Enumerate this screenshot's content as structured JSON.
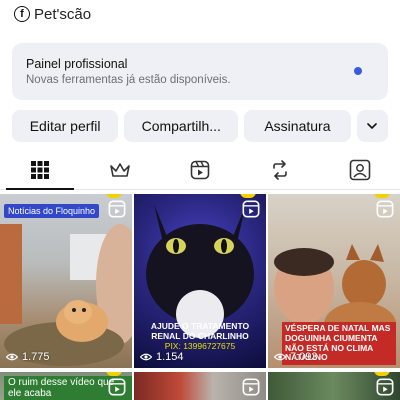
{
  "header": {
    "account_name": "Pet'scão",
    "icon": "facebook-icon"
  },
  "panel": {
    "title": "Painel profissional",
    "subtitle": "Novas ferramentas já estão disponíveis.",
    "notification_color": "#3a5bd9"
  },
  "buttons": {
    "edit": "Editar perfil",
    "share": "Compartilh...",
    "subscription": "Assinatura",
    "more_icon": "chevron-down-icon"
  },
  "tabs": [
    {
      "name": "grid",
      "icon": "grid-icon",
      "active": true
    },
    {
      "name": "crown",
      "icon": "crown-icon",
      "active": false
    },
    {
      "name": "reels",
      "icon": "reels-icon",
      "active": false
    },
    {
      "name": "repost",
      "icon": "repost-icon",
      "active": false
    },
    {
      "name": "tagged",
      "icon": "tagged-icon",
      "active": false
    }
  ],
  "posts": [
    {
      "tag": "Notícias do Floquinho",
      "views": "1.775"
    },
    {
      "caption": "AJUDE O TRATAMENTO RENAL DO CHARLINHO",
      "caption_extra": "PIX: 13996727675",
      "views": "1.154"
    },
    {
      "caption": "VÉSPERA DE NATAL MAS DOGUINHA CIUMENTA NÃO ESTÁ NO CLIMA NATALINO",
      "views": "7.093"
    },
    {
      "caption": "O ruim desse vídeo que ele acaba"
    },
    {},
    {}
  ]
}
